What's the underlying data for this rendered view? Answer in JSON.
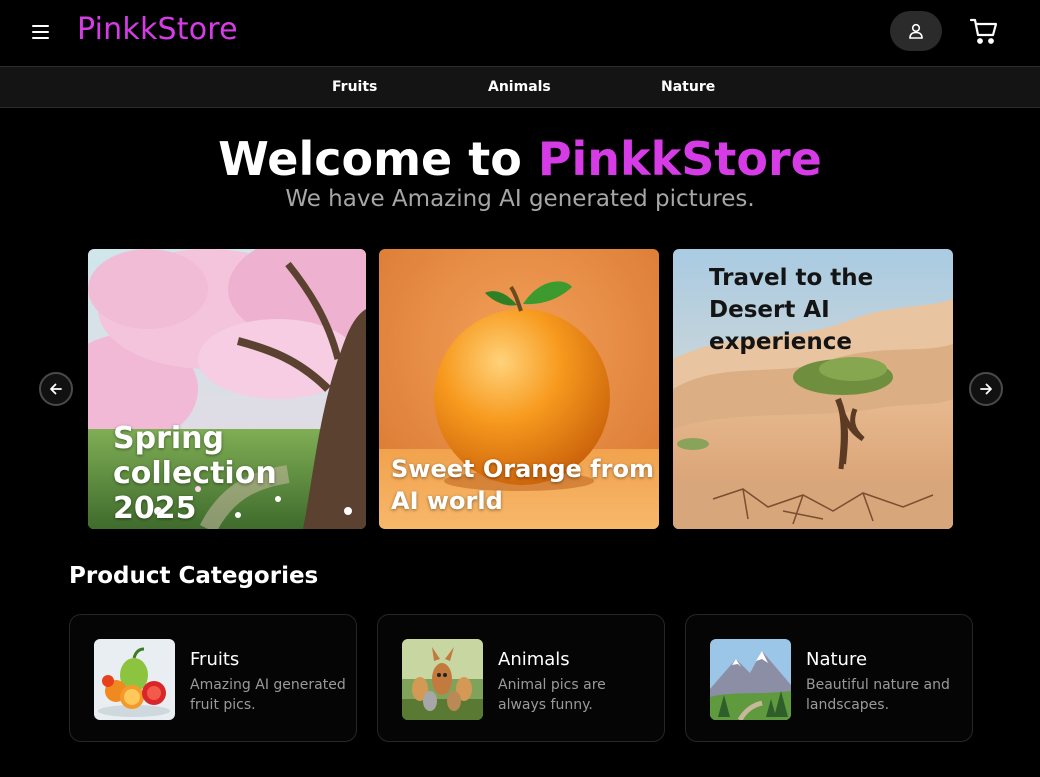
{
  "header": {
    "logo": "PinkkStore",
    "menu_icon": "hamburger-menu-icon",
    "user_icon": "user-icon",
    "cart_icon": "cart-icon"
  },
  "nav": {
    "items": [
      {
        "label": "Fruits"
      },
      {
        "label": "Animals"
      },
      {
        "label": "Nature"
      }
    ]
  },
  "hero": {
    "title_prefix": "Welcome to ",
    "title_brand": "PinkkStore",
    "subtitle": "We have Amazing AI generated pictures."
  },
  "carousel": {
    "prev_icon": "arrow-left-icon",
    "next_icon": "arrow-right-icon",
    "slides": [
      {
        "caption": "Spring collection 2025",
        "image": "cherry-blossom-tree"
      },
      {
        "caption": "Sweet Orange from AI world",
        "image": "orange-fruit"
      },
      {
        "caption": "Travel to the Desert AI experience",
        "image": "desert-tree"
      }
    ]
  },
  "categories": {
    "title": "Product Categories",
    "items": [
      {
        "name": "Fruits",
        "description": "Amazing AI generated fruit pics.",
        "image": "fruits-thumbnail"
      },
      {
        "name": "Animals",
        "description": "Animal pics are always funny.",
        "image": "animals-thumbnail"
      },
      {
        "name": "Nature",
        "description": "Beautiful nature and landscapes.",
        "image": "nature-thumbnail"
      }
    ]
  },
  "colors": {
    "brand": "#d63ce6",
    "background": "#000000",
    "nav_bar": "#141414"
  }
}
